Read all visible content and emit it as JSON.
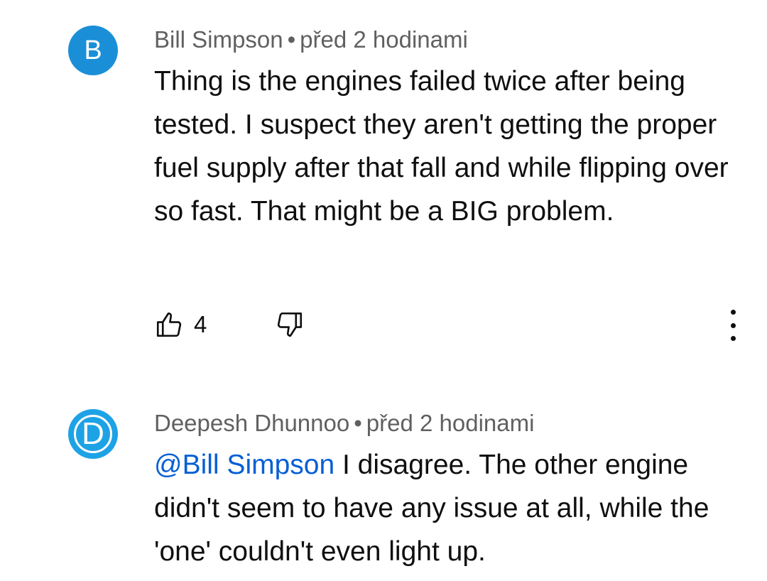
{
  "comments": [
    {
      "avatar_letter": "B",
      "author": "Bill Simpson",
      "separator": "•",
      "time": "před 2 hodinami",
      "text": "Thing is the engines failed twice after being tested. I suspect they aren't getting the proper fuel supply after that fall and while flipping over so fast. That might be a BIG problem.",
      "like_count": "4",
      "avatar_color": "#1a8fd8"
    },
    {
      "avatar_letter": "D",
      "author": "Deepesh Dhunnoo",
      "separator": "•",
      "time": "před 2 hodinami",
      "mention": "@Bill Simpson",
      "text": " I disagree. The other engine didn't seem to have any issue at all, while the 'one' couldn't even light up.",
      "avatar_color": "#1ea2e6"
    }
  ],
  "colors": {
    "mention": "#065fd4",
    "meta": "#606060",
    "text": "#0f0f0f"
  },
  "icons": {
    "like": "thumbs-up-icon",
    "dislike": "thumbs-down-icon",
    "more": "more-vertical-icon"
  }
}
